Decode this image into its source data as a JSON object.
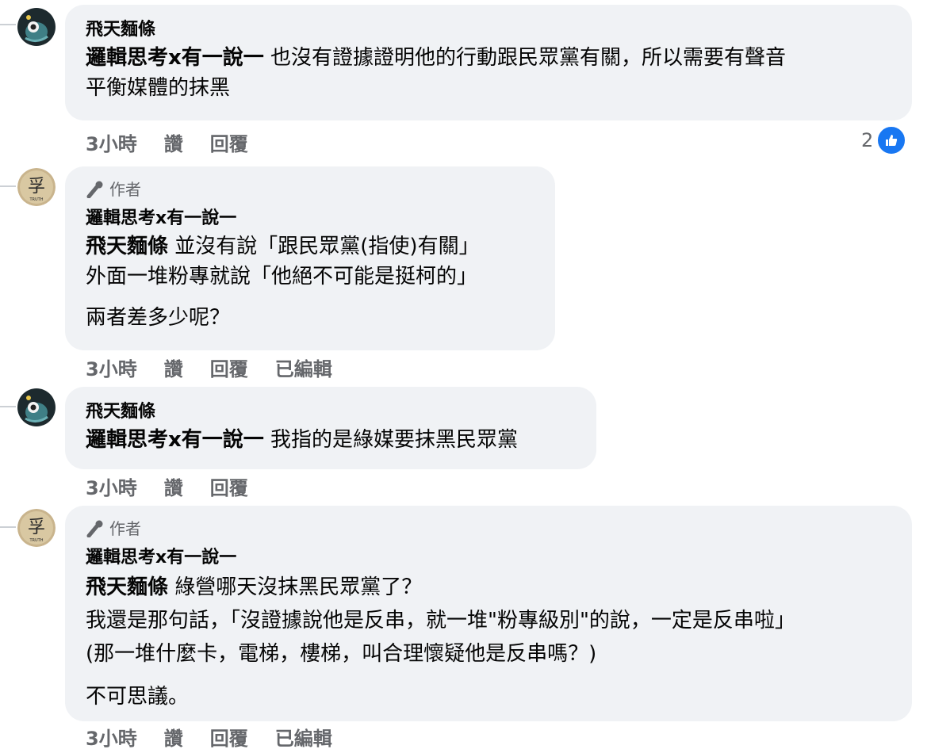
{
  "comments": [
    {
      "name": "飛天麵條",
      "mention": "邏輯思考x有一說一",
      "text_line1": " 也沒有證據證明他的行動跟民眾黨有關，所以需要有聲音",
      "text_line2": "平衡媒體的抹黑",
      "time": "3小時",
      "like": "讚",
      "reply": "回覆",
      "reactions": "2",
      "reaction_icon": "like-icon"
    },
    {
      "author_badge": "作者",
      "name": "邏輯思考x有一說一",
      "mention": "飛天麵條",
      "text_line1": " 並沒有說「跟民眾黨(指使)有關」",
      "text_line2": "外面一堆粉專就說「他絕不可能是挺柯的」",
      "text_line3": "兩者差多少呢？",
      "time": "3小時",
      "like": "讚",
      "reply": "回覆",
      "edited": "已編輯"
    },
    {
      "name": "飛天麵條",
      "mention": "邏輯思考x有一說一",
      "text_line1": " 我指的是綠媒要抹黑民眾黨",
      "time": "3小時",
      "like": "讚",
      "reply": "回覆"
    },
    {
      "author_badge": "作者",
      "name": "邏輯思考x有一說一",
      "mention": "飛天麵條",
      "text_line1": " 綠營哪天沒抹黑民眾黨了？",
      "text_line2": "我還是那句話，「沒證據說他是反串，就一堆\"粉專級別\"的說，一定是反串啦」",
      "text_line3": "(那一堆什麼卡，電梯，樓梯，叫合理懷疑他是反串嗎？)",
      "text_line4": "不可思議。",
      "time": "3小時",
      "like": "讚",
      "reply": "回覆",
      "edited": "已編輯"
    }
  ],
  "avatar_truth": {
    "glyph": "孚",
    "caption": "TRUTH"
  },
  "colors": {
    "bubble": "#f0f2f5",
    "meta": "#65676b",
    "like_blue": "#1877f2"
  }
}
